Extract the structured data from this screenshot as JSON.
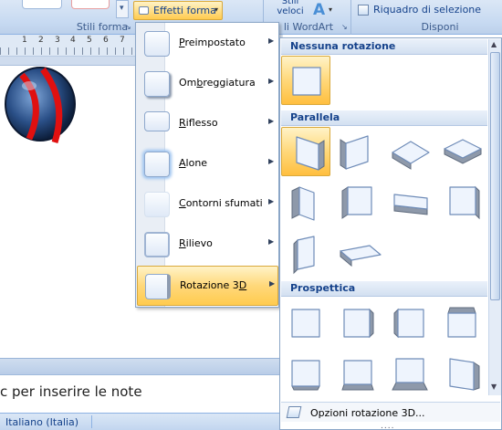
{
  "ribbon": {
    "shape_effects_button": "Effetti forma",
    "quick_styles_label": "Stili veloci",
    "selection_pane_button": "Riquadro di selezione",
    "groups": {
      "shape_styles": "Stili forma",
      "wordart_styles": "li WordArt",
      "arrange": "Disponi"
    }
  },
  "ruler": {
    "numbers": [
      "1",
      "2",
      "3",
      "4",
      "5",
      "6",
      "7",
      "8"
    ]
  },
  "notes": {
    "placeholder": "c per inserire le note"
  },
  "statusbar": {
    "language": "Italiano (Italia)"
  },
  "effects_menu": {
    "items": [
      {
        "pre": "",
        "key": "P",
        "post": "reimpostato"
      },
      {
        "pre": "Om",
        "key": "b",
        "post": "reggiatura"
      },
      {
        "pre": "",
        "key": "R",
        "post": "iflesso"
      },
      {
        "pre": "",
        "key": "A",
        "post": "lone"
      },
      {
        "pre": "",
        "key": "C",
        "post": "ontorni sfumati"
      },
      {
        "pre": "",
        "key": "R",
        "post": "ilievo"
      },
      {
        "pre": "Rotazione 3",
        "key": "D",
        "post": ""
      }
    ],
    "selected_index": 6
  },
  "rotation_gallery": {
    "sections": {
      "none": "Nessuna rotazione",
      "parallel": "Parallela",
      "perspective": "Prospettica"
    },
    "footer_option": "Opzioni rotazione 3D...",
    "grip": "....",
    "selected_preset": "Parallela 1"
  },
  "colors": {
    "ribbon_bg": "#c6d9f1",
    "highlight": "#ffd87a",
    "section_header_text": "#15428b",
    "shape_red_stripe": "#e01010",
    "shape_body": "#2a4f87"
  }
}
